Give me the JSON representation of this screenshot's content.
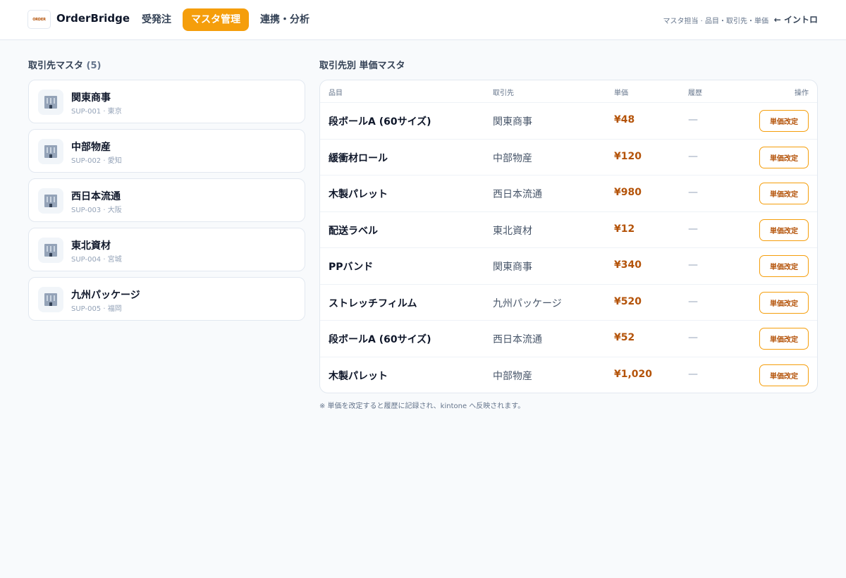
{
  "header": {
    "logo_text": "ORDER",
    "brand": "OrderBridge",
    "nav": [
      {
        "label": "受発注",
        "active": false
      },
      {
        "label": "マスタ管理",
        "active": true
      },
      {
        "label": "連携・分析",
        "active": false
      }
    ],
    "context": "マスタ担当 · 品目・取引先・単価",
    "intro_link": "← イントロ"
  },
  "suppliers": {
    "title": "取引先マスタ",
    "count": "(5)",
    "items": [
      {
        "icon": "building-icon",
        "name": "関東商事",
        "meta": "SUP-001 · 東京"
      },
      {
        "icon": "building-icon",
        "name": "中部物産",
        "meta": "SUP-002 · 愛知"
      },
      {
        "icon": "building-icon",
        "name": "西日本流通",
        "meta": "SUP-003 · 大阪"
      },
      {
        "icon": "building-icon",
        "name": "東北資材",
        "meta": "SUP-004 · 宮城"
      },
      {
        "icon": "building-icon",
        "name": "九州パッケージ",
        "meta": "SUP-005 · 福岡"
      }
    ]
  },
  "prices": {
    "title": "取引先別 単価マスタ",
    "columns": {
      "item": "品目",
      "supplier": "取引先",
      "price": "単価",
      "history": "履歴",
      "action": "操作"
    },
    "rows": [
      {
        "item": "段ボールA (60サイズ)",
        "supplier": "関東商事",
        "price": "¥48",
        "history": "—",
        "action": "単価改定"
      },
      {
        "item": "緩衝材ロール",
        "supplier": "中部物産",
        "price": "¥120",
        "history": "—",
        "action": "単価改定"
      },
      {
        "item": "木製パレット",
        "supplier": "西日本流通",
        "price": "¥980",
        "history": "—",
        "action": "単価改定"
      },
      {
        "item": "配送ラベル",
        "supplier": "東北資材",
        "price": "¥12",
        "history": "—",
        "action": "単価改定"
      },
      {
        "item": "PPバンド",
        "supplier": "関東商事",
        "price": "¥340",
        "history": "—",
        "action": "単価改定"
      },
      {
        "item": "ストレッチフィルム",
        "supplier": "九州パッケージ",
        "price": "¥520",
        "history": "—",
        "action": "単価改定"
      },
      {
        "item": "段ボールA (60サイズ)",
        "supplier": "西日本流通",
        "price": "¥52",
        "history": "—",
        "action": "単価改定"
      },
      {
        "item": "木製パレット",
        "supplier": "中部物産",
        "price": "¥1,020",
        "history": "—",
        "action": "単価改定"
      }
    ],
    "footnote": "※ 単価を改定すると履歴に記録され、kintone へ反映されます。"
  },
  "colors": {
    "accent": "#f59e0b",
    "price_text": "#b45309",
    "background": "#f8fafc"
  }
}
